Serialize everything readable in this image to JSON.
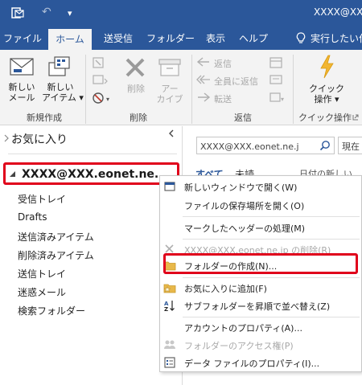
{
  "window": {
    "title": "XXXX@XX"
  },
  "quick_access": {
    "app_icon": "outlook-icon",
    "undo_glyph": "↶",
    "customize_glyph": "▾"
  },
  "tabs": [
    "ファイル",
    "ホーム",
    "送受信",
    "フォルダー",
    "表示",
    "ヘルプ",
    "実行したい作"
  ],
  "ribbon": {
    "new_mail": [
      "新しい",
      "メール"
    ],
    "new_item": [
      "新しい",
      "アイテム ▾"
    ],
    "new_group": "新規作成",
    "delete_label": "削除",
    "archive": [
      "アー",
      "カイブ"
    ],
    "delete_group": "削除",
    "reply": "返信",
    "reply_all": "全員に返信",
    "forward": "転送",
    "respond_group": "返信",
    "quick_steps": [
      "クイック",
      "操作 ▾"
    ],
    "quick_group": "クイック操作"
  },
  "nav": {
    "favorites": "お気に入り",
    "account": "XXXX@XXX.eonet.ne...",
    "folders": [
      "受信トレイ",
      "Drafts",
      "送信済みアイテム",
      "削除済みアイテム",
      "送信トレイ",
      "迷惑メール",
      "検索フォルダー"
    ]
  },
  "search": {
    "value": "XXXX@XXX.eonet.ne.j",
    "scope": "現在"
  },
  "mail_filters": {
    "all": "すべて",
    "unread": "未読",
    "sort": "日付の新しい"
  },
  "context_menu": {
    "items": [
      {
        "label": "新しいウィンドウで開く(W)",
        "enabled": true,
        "icon": "new-window-icon"
      },
      {
        "label": "ファイルの保存場所を開く(O)",
        "enabled": true,
        "icon": ""
      },
      {
        "label": "マークしたヘッダーの処理(M)",
        "enabled": true,
        "icon": ""
      },
      {
        "label": "XXXX@XXX.eonet.ne.jp の削除(R)",
        "enabled": false,
        "icon": "delete-account-icon"
      },
      {
        "label": "フォルダーの作成(N)...",
        "enabled": true,
        "icon": "folder-icon"
      },
      {
        "label": "お気に入りに追加(F)",
        "enabled": true,
        "icon": "star-folder-icon"
      },
      {
        "label": "サブフォルダーを昇順で並べ替え(Z)",
        "enabled": true,
        "icon": "sort-az-icon"
      },
      {
        "label": "アカウントのプロパティ(A)...",
        "enabled": true,
        "icon": ""
      },
      {
        "label": "フォルダーのアクセス権(P)",
        "enabled": false,
        "icon": "permissions-icon"
      },
      {
        "label": "データ ファイルのプロパティ(I)...",
        "enabled": true,
        "icon": "properties-icon"
      }
    ]
  },
  "colors": {
    "brand": "#2b579a",
    "highlight": "#e0001b",
    "link": "#2b579a",
    "disabled": "#a8a8a8"
  }
}
